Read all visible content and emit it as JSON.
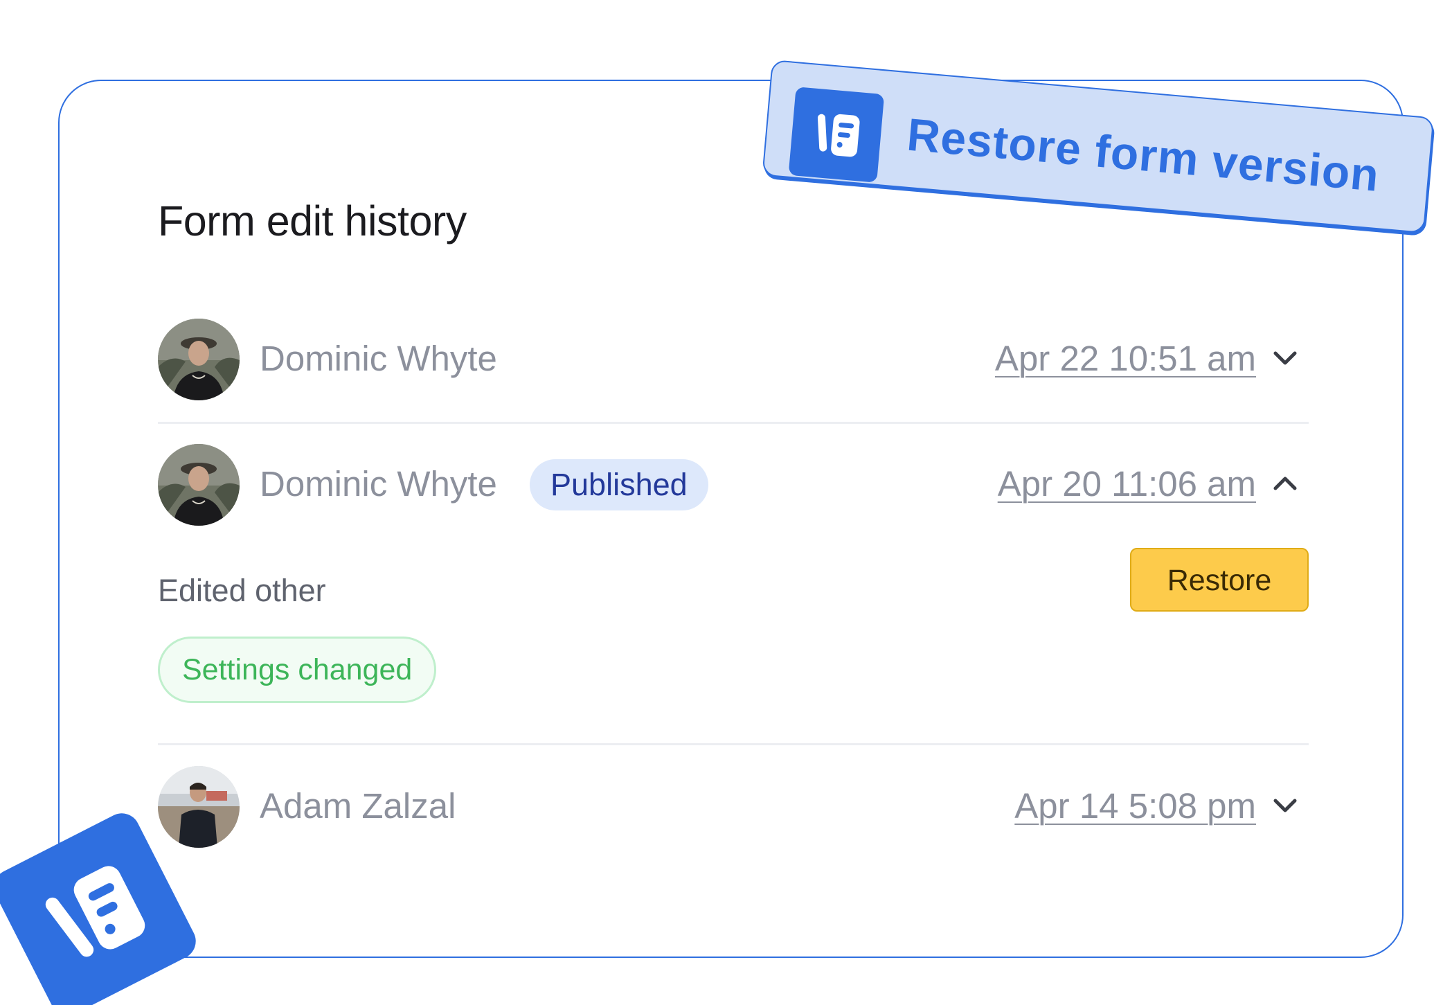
{
  "banner": {
    "title": "Restore form version",
    "icon": "form-logo-icon"
  },
  "history": {
    "title": "Form edit history",
    "entries": [
      {
        "user": "Dominic Whyte",
        "badge": "",
        "timestamp": "Apr 22 10:51 am",
        "expanded": false,
        "chevron": "chevron-down-icon",
        "avatar": "avatar-dominic"
      },
      {
        "user": "Dominic Whyte",
        "badge": "Published",
        "timestamp": "Apr 20 11:06 am",
        "expanded": true,
        "chevron": "chevron-up-icon",
        "avatar": "avatar-dominic",
        "details": {
          "edit_label": "Edited other",
          "tags": [
            "Settings changed"
          ],
          "restore_label": "Restore"
        }
      },
      {
        "user": "Adam Zalzal",
        "badge": "",
        "timestamp": "Apr 14 5:08 pm",
        "expanded": false,
        "chevron": "chevron-down-icon",
        "avatar": "avatar-adam"
      }
    ]
  },
  "colors": {
    "brand_blue": "#2f6fe0",
    "banner_bg": "#cfdef8",
    "badge_bg": "#dde8fb",
    "badge_text": "#23399a",
    "restore_bg": "#fdcb4b",
    "tag_green": "#3db559",
    "muted_text": "#8c909c"
  },
  "corner_logo": {
    "icon": "form-logo-icon"
  }
}
